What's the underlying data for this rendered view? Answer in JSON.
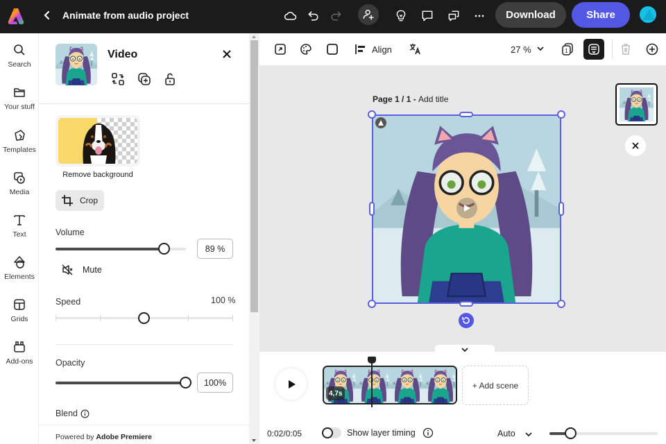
{
  "topbar": {
    "title": "Animate from audio project",
    "download_label": "Download",
    "share_label": "Share",
    "icons": [
      "app-logo",
      "back-chevron",
      "cloud-sync",
      "undo",
      "redo",
      "invite-user",
      "lightbulb",
      "comment",
      "comments",
      "more"
    ]
  },
  "rail": {
    "items": [
      {
        "label": "Search",
        "icon": "search-icon"
      },
      {
        "label": "Your stuff",
        "icon": "folder-icon"
      },
      {
        "label": "Templates",
        "icon": "templates-icon"
      },
      {
        "label": "Media",
        "icon": "media-icon"
      },
      {
        "label": "Text",
        "icon": "text-icon"
      },
      {
        "label": "Elements",
        "icon": "elements-icon"
      },
      {
        "label": "Grids",
        "icon": "grids-icon"
      },
      {
        "label": "Add-ons",
        "icon": "addons-icon"
      }
    ]
  },
  "panel": {
    "heading": "Video",
    "remove_bg_label": "Remove background",
    "crop_label": "Crop",
    "volume": {
      "label": "Volume",
      "value_text": "89 %",
      "value": 89
    },
    "mute_label": "Mute",
    "speed": {
      "label": "Speed",
      "value_text": "100 %",
      "position": 0.5
    },
    "opacity": {
      "label": "Opacity",
      "value_text": "100%",
      "value": 100
    },
    "blend_label": "Blend",
    "powered_prefix": "Powered by ",
    "powered_brand": "Adobe Premiere"
  },
  "canvas_toolbar": {
    "align_label": "Align",
    "zoom_label": "27 %",
    "page_count": "1"
  },
  "canvas": {
    "page_prefix": "Page 1 / 1 - ",
    "page_title_placeholder": "Add title",
    "colors": {
      "selection": "#5b5fe0",
      "accent": "#5258e4"
    }
  },
  "timeline": {
    "scene_duration": "4,7s",
    "add_scene_label": "+ Add scene",
    "time": "0:02/0:05",
    "layer_timing_label": "Show layer timing",
    "layer_timing_on": false,
    "zoom_mode": "Auto",
    "timeline_zoom": 0.2,
    "playhead_fraction": 0.36
  }
}
